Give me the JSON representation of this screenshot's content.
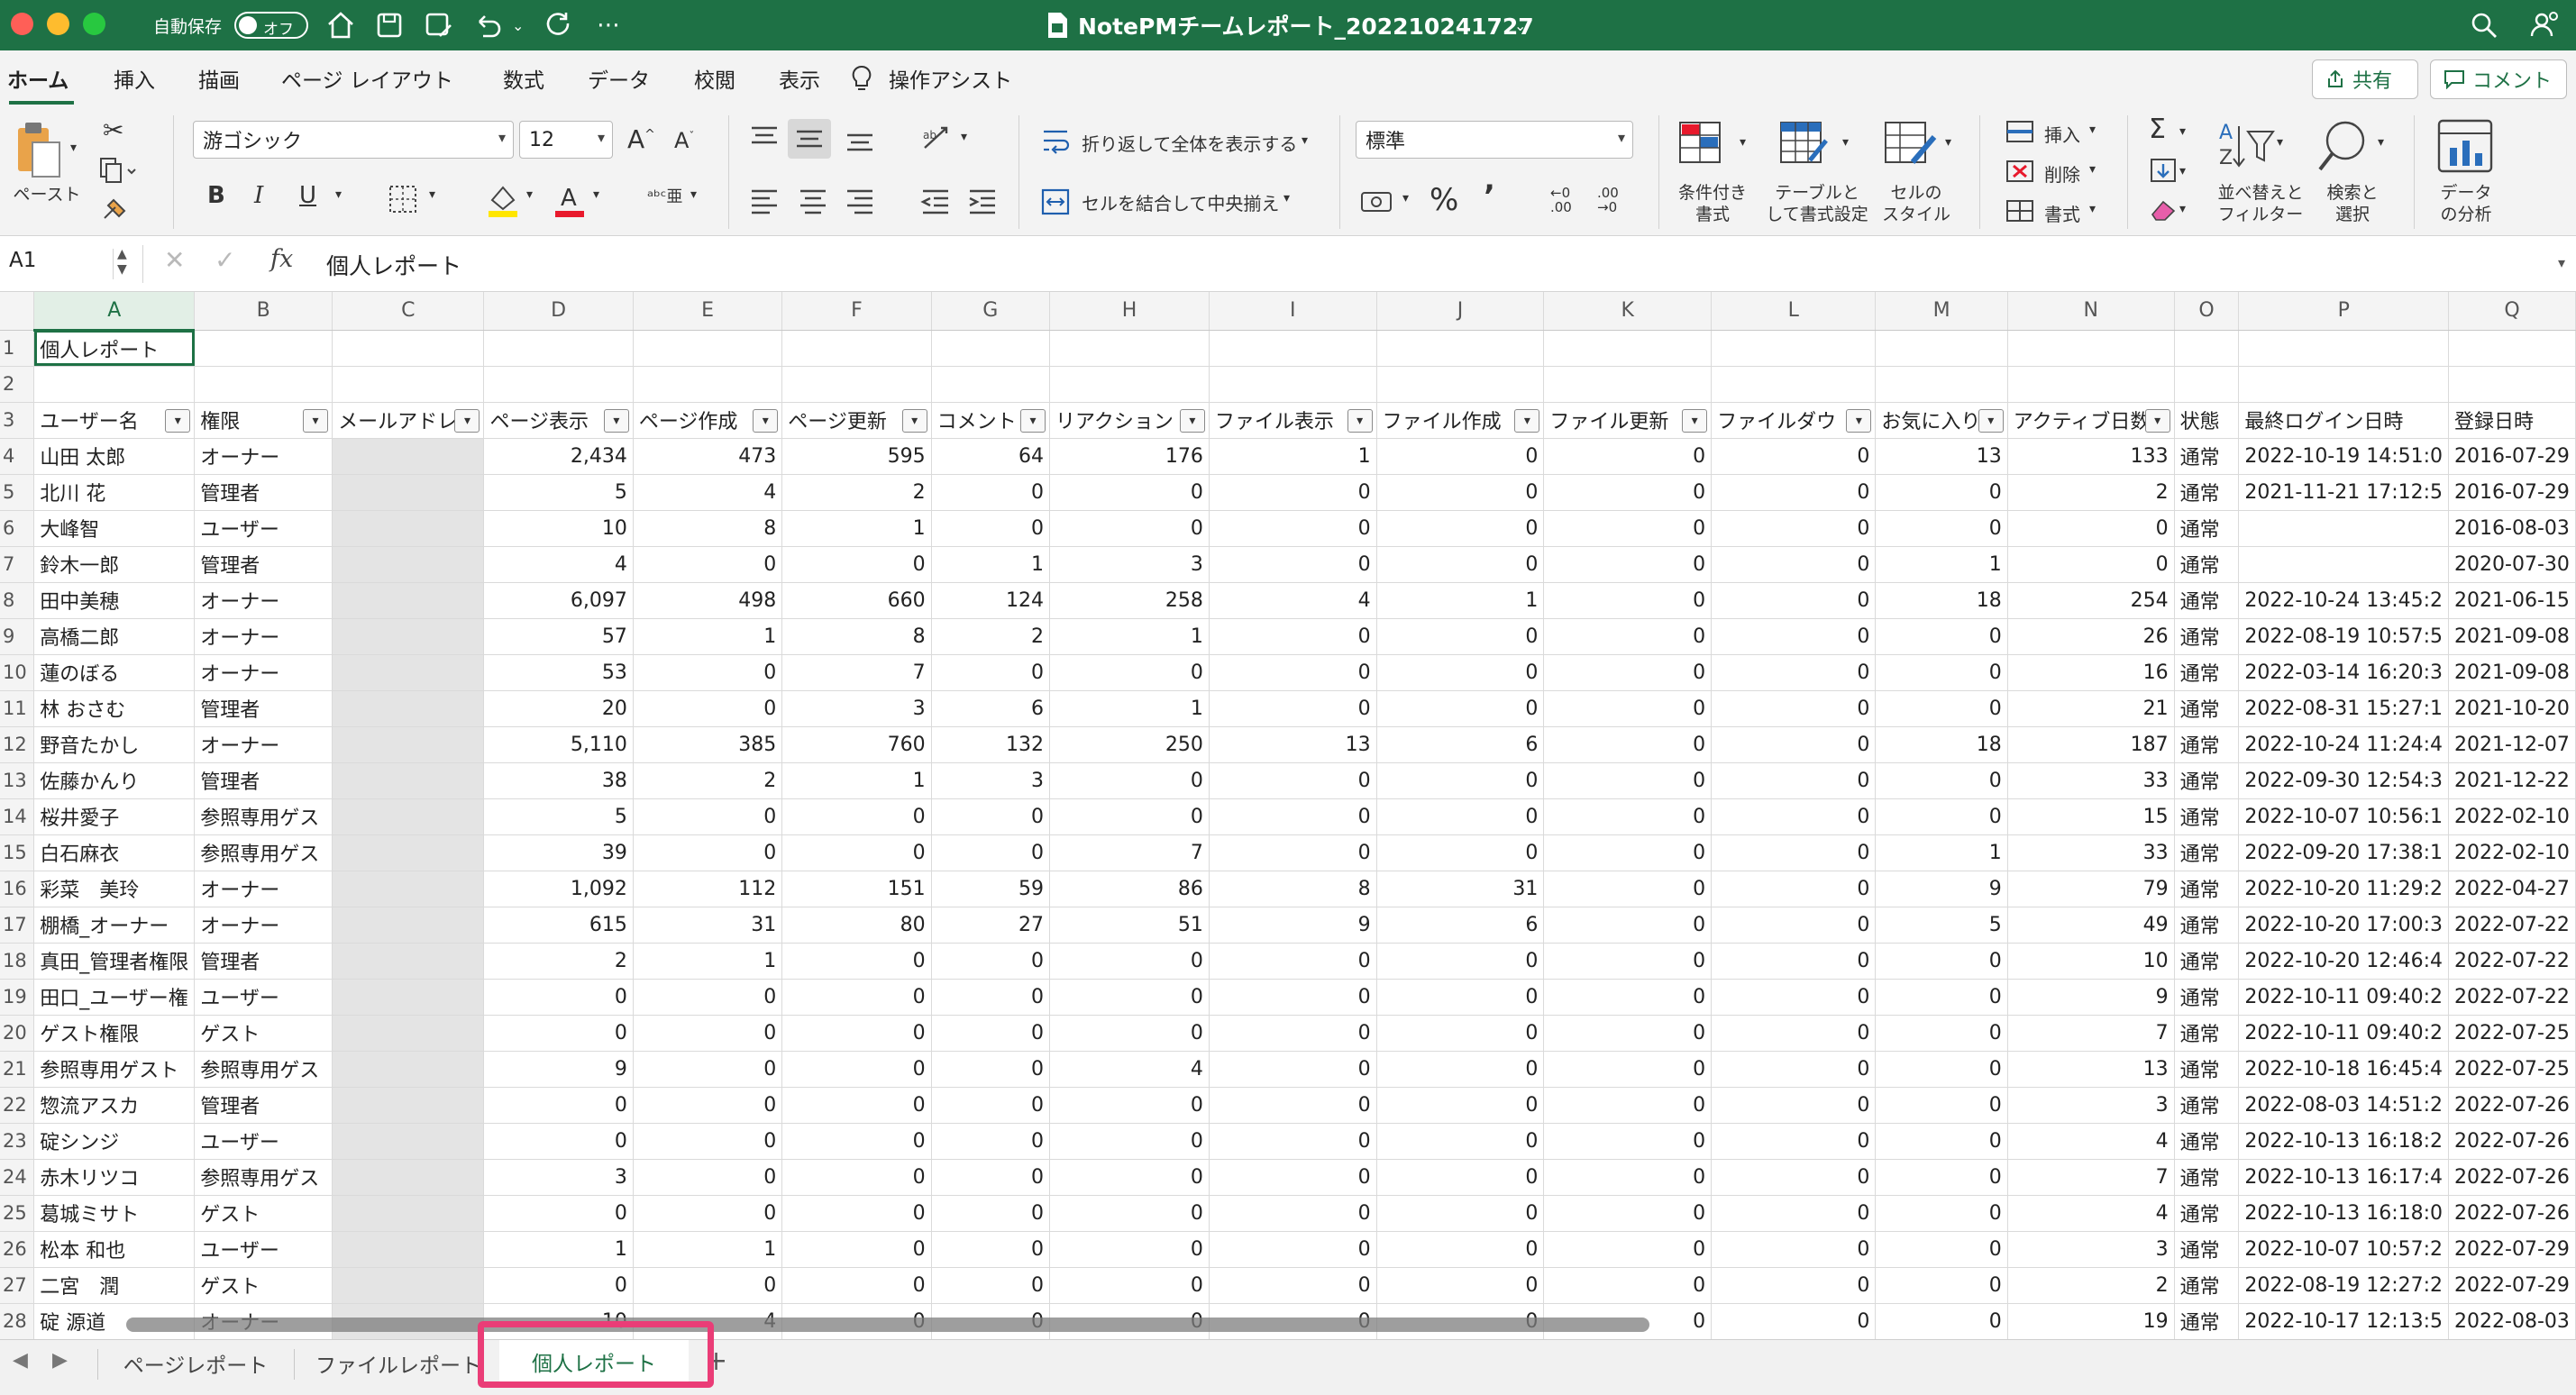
{
  "titlebar": {
    "autosave_label": "自動保存",
    "autosave_state": "オフ",
    "doc_title": "NotePMチームレポート_202210241727",
    "icons": [
      "home-icon",
      "save-icon",
      "save-as-icon",
      "undo-icon",
      "redo-icon",
      "more-icon",
      "search-icon",
      "account-icon"
    ]
  },
  "menu": {
    "tabs": [
      "ホーム",
      "挿入",
      "描画",
      "ページ レイアウト",
      "数式",
      "データ",
      "校閲",
      "表示"
    ],
    "assist": "操作アシスト",
    "share": "共有",
    "comment": "コメント"
  },
  "ribbon": {
    "paste": "ペースト",
    "font_name": "游ゴシック",
    "font_size": "12",
    "wrap_text": "折り返して全体を表示する",
    "merge_center": "セルを結合して中央揃え",
    "number_format": "標準",
    "conditional_format": [
      "条件付き",
      "書式"
    ],
    "format_as_table": [
      "テーブルと",
      "して書式設定"
    ],
    "cell_styles": [
      "セルの",
      "スタイル"
    ],
    "insert": "挿入",
    "delete": "削除",
    "format": "書式",
    "sort_filter": [
      "並べ替えと",
      "フィルター"
    ],
    "find_select": [
      "検索と",
      "選択"
    ],
    "analyze": [
      "データ",
      "の分析"
    ],
    "bold": "B",
    "italic": "I",
    "underline": "U"
  },
  "formula_bar": {
    "cell_ref": "A1",
    "fx": "fx",
    "content": "個人レポート"
  },
  "columns": [
    "A",
    "B",
    "C",
    "D",
    "E",
    "F",
    "G",
    "H",
    "I",
    "J",
    "K",
    "L",
    "M",
    "N",
    "O",
    "P",
    "Q"
  ],
  "sheet": {
    "a1": "個人レポート",
    "headers": [
      "ユーザー名",
      "権限",
      "メールアドレ",
      "ページ表示",
      "ページ作成",
      "ページ更新",
      "コメント",
      "リアクション",
      "ファイル表示",
      "ファイル作成",
      "ファイル更新",
      "ファイルダウ",
      "お気に入り",
      "アクティブ日数",
      "状態",
      "最終ログイン日時",
      "登録日時"
    ],
    "rows": [
      [
        "山田 太郎",
        "オーナー",
        "",
        "2,434",
        "473",
        "595",
        "64",
        "176",
        "1",
        "0",
        "0",
        "0",
        "13",
        "133",
        "通常",
        "2022-10-19 14:51:0",
        "2016-07-29"
      ],
      [
        "北川 花",
        "管理者",
        "",
        "5",
        "4",
        "2",
        "0",
        "0",
        "0",
        "0",
        "0",
        "0",
        "0",
        "2",
        "通常",
        "2021-11-21 17:12:5",
        "2016-07-29"
      ],
      [
        "大峰智",
        "ユーザー",
        "",
        "10",
        "8",
        "1",
        "0",
        "0",
        "0",
        "0",
        "0",
        "0",
        "0",
        "0",
        "通常",
        "",
        "2016-08-03"
      ],
      [
        "鈴木一郎",
        "管理者",
        "",
        "4",
        "0",
        "0",
        "1",
        "3",
        "0",
        "0",
        "0",
        "0",
        "1",
        "0",
        "通常",
        "",
        "2020-07-30"
      ],
      [
        "田中美穂",
        "オーナー",
        "",
        "6,097",
        "498",
        "660",
        "124",
        "258",
        "4",
        "1",
        "0",
        "0",
        "18",
        "254",
        "通常",
        "2022-10-24 13:45:2",
        "2021-06-15"
      ],
      [
        "高橋二郎",
        "オーナー",
        "",
        "57",
        "1",
        "8",
        "2",
        "1",
        "0",
        "0",
        "0",
        "0",
        "0",
        "26",
        "通常",
        "2022-08-19 10:57:5",
        "2021-09-08"
      ],
      [
        "蓮のぼる",
        "オーナー",
        "",
        "53",
        "0",
        "7",
        "0",
        "0",
        "0",
        "0",
        "0",
        "0",
        "0",
        "16",
        "通常",
        "2022-03-14 16:20:3",
        "2021-09-08"
      ],
      [
        "林 おさむ",
        "管理者",
        "",
        "20",
        "0",
        "3",
        "6",
        "1",
        "0",
        "0",
        "0",
        "0",
        "0",
        "21",
        "通常",
        "2022-08-31 15:27:1",
        "2021-10-20"
      ],
      [
        "野音たかし",
        "オーナー",
        "",
        "5,110",
        "385",
        "760",
        "132",
        "250",
        "13",
        "6",
        "0",
        "0",
        "18",
        "187",
        "通常",
        "2022-10-24 11:24:4",
        "2021-12-07"
      ],
      [
        "佐藤かんり",
        "管理者",
        "",
        "38",
        "2",
        "1",
        "3",
        "0",
        "0",
        "0",
        "0",
        "0",
        "0",
        "33",
        "通常",
        "2022-09-30 12:54:3",
        "2021-12-22"
      ],
      [
        "桜井愛子",
        "参照専用ゲス",
        "",
        "5",
        "0",
        "0",
        "0",
        "0",
        "0",
        "0",
        "0",
        "0",
        "0",
        "15",
        "通常",
        "2022-10-07 10:56:1",
        "2022-02-10"
      ],
      [
        "白石麻衣",
        "参照専用ゲス",
        "",
        "39",
        "0",
        "0",
        "0",
        "7",
        "0",
        "0",
        "0",
        "0",
        "1",
        "33",
        "通常",
        "2022-09-20 17:38:1",
        "2022-02-10"
      ],
      [
        "彩菜　美玲",
        "オーナー",
        "",
        "1,092",
        "112",
        "151",
        "59",
        "86",
        "8",
        "31",
        "0",
        "0",
        "9",
        "79",
        "通常",
        "2022-10-20 11:29:2",
        "2022-04-27"
      ],
      [
        "棚橋_オーナー",
        "オーナー",
        "",
        "615",
        "31",
        "80",
        "27",
        "51",
        "9",
        "6",
        "0",
        "0",
        "5",
        "49",
        "通常",
        "2022-10-20 17:00:3",
        "2022-07-22"
      ],
      [
        "真田_管理者権限",
        "管理者",
        "",
        "2",
        "1",
        "0",
        "0",
        "0",
        "0",
        "0",
        "0",
        "0",
        "0",
        "10",
        "通常",
        "2022-10-20 12:46:4",
        "2022-07-22"
      ],
      [
        "田口_ユーザー権",
        "ユーザー",
        "",
        "0",
        "0",
        "0",
        "0",
        "0",
        "0",
        "0",
        "0",
        "0",
        "0",
        "9",
        "通常",
        "2022-10-11 09:40:2",
        "2022-07-22"
      ],
      [
        "ゲスト権限",
        "ゲスト",
        "",
        "0",
        "0",
        "0",
        "0",
        "0",
        "0",
        "0",
        "0",
        "0",
        "0",
        "7",
        "通常",
        "2022-10-11 09:40:2",
        "2022-07-25"
      ],
      [
        "参照専用ゲスト",
        "参照専用ゲス",
        "",
        "9",
        "0",
        "0",
        "0",
        "4",
        "0",
        "0",
        "0",
        "0",
        "0",
        "13",
        "通常",
        "2022-10-18 16:45:4",
        "2022-07-25"
      ],
      [
        "惣流アスカ",
        "管理者",
        "",
        "0",
        "0",
        "0",
        "0",
        "0",
        "0",
        "0",
        "0",
        "0",
        "0",
        "3",
        "通常",
        "2022-08-03 14:51:2",
        "2022-07-26"
      ],
      [
        "碇シンジ",
        "ユーザー",
        "",
        "0",
        "0",
        "0",
        "0",
        "0",
        "0",
        "0",
        "0",
        "0",
        "0",
        "4",
        "通常",
        "2022-10-13 16:18:2",
        "2022-07-26"
      ],
      [
        "赤木リツコ",
        "参照専用ゲス",
        "",
        "3",
        "0",
        "0",
        "0",
        "0",
        "0",
        "0",
        "0",
        "0",
        "0",
        "7",
        "通常",
        "2022-10-13 16:17:4",
        "2022-07-26"
      ],
      [
        "葛城ミサト",
        "ゲスト",
        "",
        "0",
        "0",
        "0",
        "0",
        "0",
        "0",
        "0",
        "0",
        "0",
        "0",
        "4",
        "通常",
        "2022-10-13 16:18:0",
        "2022-07-26"
      ],
      [
        "松本 和也",
        "ユーザー",
        "",
        "1",
        "1",
        "0",
        "0",
        "0",
        "0",
        "0",
        "0",
        "0",
        "0",
        "3",
        "通常",
        "2022-10-07 10:57:2",
        "2022-07-29"
      ],
      [
        "二宮　潤",
        "ゲスト",
        "",
        "0",
        "0",
        "0",
        "0",
        "0",
        "0",
        "0",
        "0",
        "0",
        "0",
        "2",
        "通常",
        "2022-08-19 12:27:2",
        "2022-07-29"
      ],
      [
        "碇 源道",
        "オーナー",
        "",
        "10",
        "4",
        "0",
        "0",
        "0",
        "0",
        "0",
        "0",
        "0",
        "0",
        "19",
        "通常",
        "2022-10-17 12:13:5",
        "2022-08-03"
      ]
    ]
  },
  "sheet_tabs": [
    "ページレポート",
    "ファイルレポート",
    "個人レポート"
  ],
  "active_sheet": "個人レポート",
  "colors": {
    "accent": "#1e7145",
    "highlight": "#ea3d77"
  }
}
